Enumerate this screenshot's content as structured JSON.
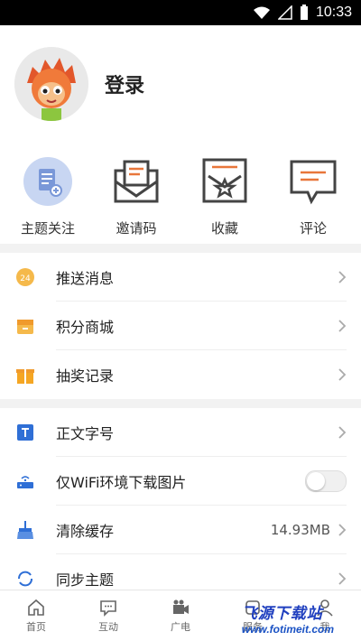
{
  "status_bar": {
    "time": "10:33"
  },
  "profile": {
    "login_label": "登录"
  },
  "quick_actions": [
    {
      "label": "主题关注",
      "icon": "document-plus-icon"
    },
    {
      "label": "邀请码",
      "icon": "envelope-icon"
    },
    {
      "label": "收藏",
      "icon": "star-bookmark-icon"
    },
    {
      "label": "评论",
      "icon": "comment-icon"
    }
  ],
  "menu_group_1": [
    {
      "label": "推送消息",
      "icon": "push-badge-icon"
    },
    {
      "label": "积分商城",
      "icon": "store-icon"
    },
    {
      "label": "抽奖记录",
      "icon": "gift-icon"
    }
  ],
  "menu_group_2": [
    {
      "label": "正文字号",
      "icon": "text-size-icon"
    },
    {
      "label": "仅WiFi环境下载图片",
      "icon": "router-icon",
      "toggle": false
    },
    {
      "label": "清除缓存",
      "icon": "broom-icon",
      "value": "14.93MB"
    },
    {
      "label": "同步主题",
      "icon": "sync-icon"
    }
  ],
  "tab_bar": [
    {
      "label": "首页",
      "icon": "home-icon"
    },
    {
      "label": "互动",
      "icon": "chat-icon"
    },
    {
      "label": "广电",
      "icon": "camera-icon"
    },
    {
      "label": "服务",
      "icon": "service-icon"
    },
    {
      "label": "我",
      "icon": "user-icon"
    }
  ],
  "watermark": {
    "top": "飞源下载站",
    "url": "www.fotimeit.com"
  },
  "colors": {
    "accent": "#e8763a",
    "blue": "#2f6fd6",
    "orange": "#f5a623"
  }
}
